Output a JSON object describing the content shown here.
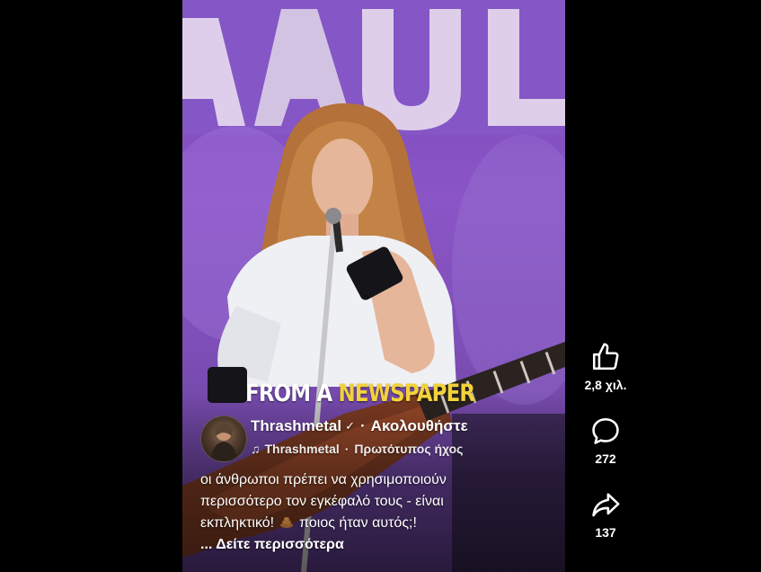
{
  "video": {
    "overlay_title_part1": "FROM A",
    "overlay_title_part2": "NEWSPAPER",
    "stage_sign_text": "AUL",
    "colors": {
      "stage": "#7e4fb8",
      "headline_accent": "#f2d23a"
    }
  },
  "author": {
    "name": "Thrashmetal",
    "verified_icon": "verified-badge-icon",
    "separator": "·",
    "follow_label": "Ακολουθήστε"
  },
  "audio": {
    "icon": "music-note-icon",
    "artist": "Thrashmetal",
    "separator": "·",
    "label": "Πρωτότυπος ήχος"
  },
  "description": {
    "line1": "οι άνθρωποι πρέπει να χρησιμοποιούν",
    "line2": "περισσότερο τον εγκέφαλό τους - είναι",
    "line3a": "εκπληκτικό!",
    "emoji_icon": "poop-emoji-icon",
    "line3b": "ποιος ήταν αυτός;!",
    "see_more": "... Δείτε περισσότερα"
  },
  "actions": {
    "like": {
      "icon": "thumbs-up-icon",
      "count": "2,8 χιλ."
    },
    "comment": {
      "icon": "comment-bubble-icon",
      "count": "272"
    },
    "share": {
      "icon": "share-arrow-icon",
      "count": "137"
    }
  }
}
